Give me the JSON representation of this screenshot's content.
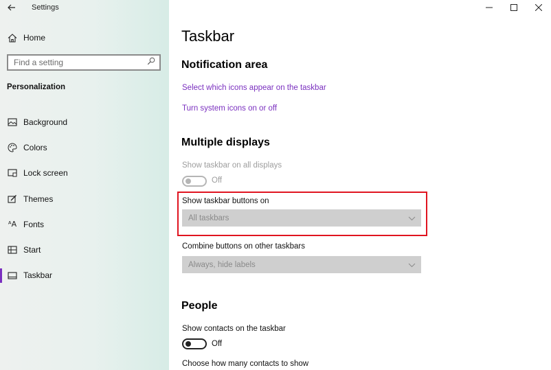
{
  "window": {
    "title": "Settings",
    "controls": [
      "—",
      "☐",
      "✕"
    ]
  },
  "sidebar": {
    "home_label": "Home",
    "search_placeholder": "Find a setting",
    "section_title": "Personalization",
    "items": [
      {
        "label": "Background",
        "icon": "image-icon"
      },
      {
        "label": "Colors",
        "icon": "palette-icon"
      },
      {
        "label": "Lock screen",
        "icon": "lock-screen-icon"
      },
      {
        "label": "Themes",
        "icon": "themes-icon"
      },
      {
        "label": "Fonts",
        "icon": "fonts-icon"
      },
      {
        "label": "Start",
        "icon": "start-icon"
      },
      {
        "label": "Taskbar",
        "icon": "taskbar-icon",
        "selected": true
      }
    ]
  },
  "main": {
    "page_title": "Taskbar",
    "notification_area": {
      "heading": "Notification area",
      "link1": "Select which icons appear on the taskbar",
      "link2": "Turn system icons on or off"
    },
    "multiple_displays": {
      "heading": "Multiple displays",
      "show_taskbar_label": "Show taskbar on all displays",
      "show_taskbar_state": "Off",
      "taskbar_buttons_label": "Show taskbar buttons on",
      "taskbar_buttons_value": "All taskbars",
      "combine_label": "Combine buttons on other taskbars",
      "combine_value": "Always, hide labels"
    },
    "people": {
      "heading": "People",
      "contacts_label": "Show contacts on the taskbar",
      "contacts_state": "Off",
      "choose_label": "Choose how many contacts to show"
    }
  },
  "colors": {
    "accent": "#7a2fbf",
    "highlight": "#e0131f"
  }
}
